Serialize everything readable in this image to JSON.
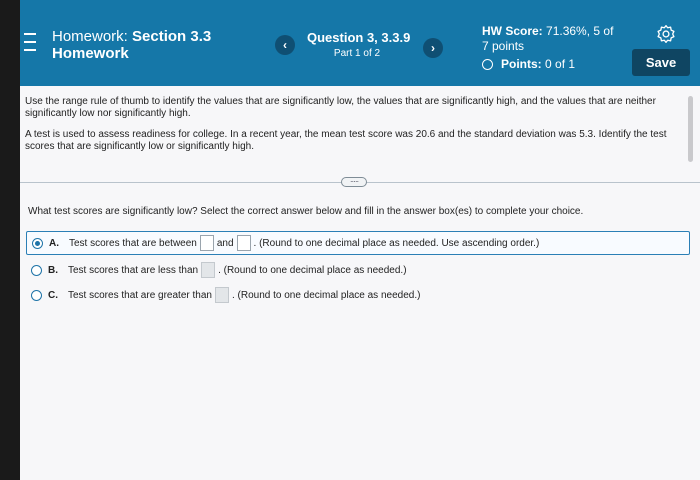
{
  "header": {
    "title_prefix": "Homework:",
    "title_section": "Section 3.3",
    "title_line2": "Homework",
    "question_title": "Question 3, 3.3.9",
    "question_part": "Part 1 of 2",
    "prev_label": "‹",
    "next_label": "›",
    "hw_score_label": "HW Score:",
    "hw_score_value": "71.36%, 5 of",
    "hw_score_line2": "7 points",
    "points_label": "Points:",
    "points_value": "0 of 1",
    "save_label": "Save"
  },
  "content": {
    "instruction": "Use the range rule of thumb to identify the values that are significantly low, the values that are significantly high, and the values that are neither significantly low nor significantly high.",
    "problem": "A test is used to assess readiness for college. In a recent year, the mean test score was 20.6 and the standard deviation was 5.3. Identify the test scores that are significantly low or significantly high.",
    "expand_label": "·····",
    "prompt": "What test scores are significantly low? Select the correct answer below and fill in the answer box(es) to complete your choice."
  },
  "options": [
    {
      "letter": "A.",
      "text_before": "Test scores that are between",
      "text_mid": "and",
      "text_after": ". (Round to one decimal place as needed. Use ascending order.)",
      "selected": true
    },
    {
      "letter": "B.",
      "text_before": "Test scores that are less than",
      "text_after": ". (Round to one decimal place as needed.)",
      "selected": false
    },
    {
      "letter": "C.",
      "text_before": "Test scores that are greater than",
      "text_after": ". (Round to one decimal place as needed.)",
      "selected": false
    }
  ],
  "colors": {
    "header_bg": "#1577a8",
    "save_bg": "#0f4562",
    "accent": "#1f74a8"
  }
}
